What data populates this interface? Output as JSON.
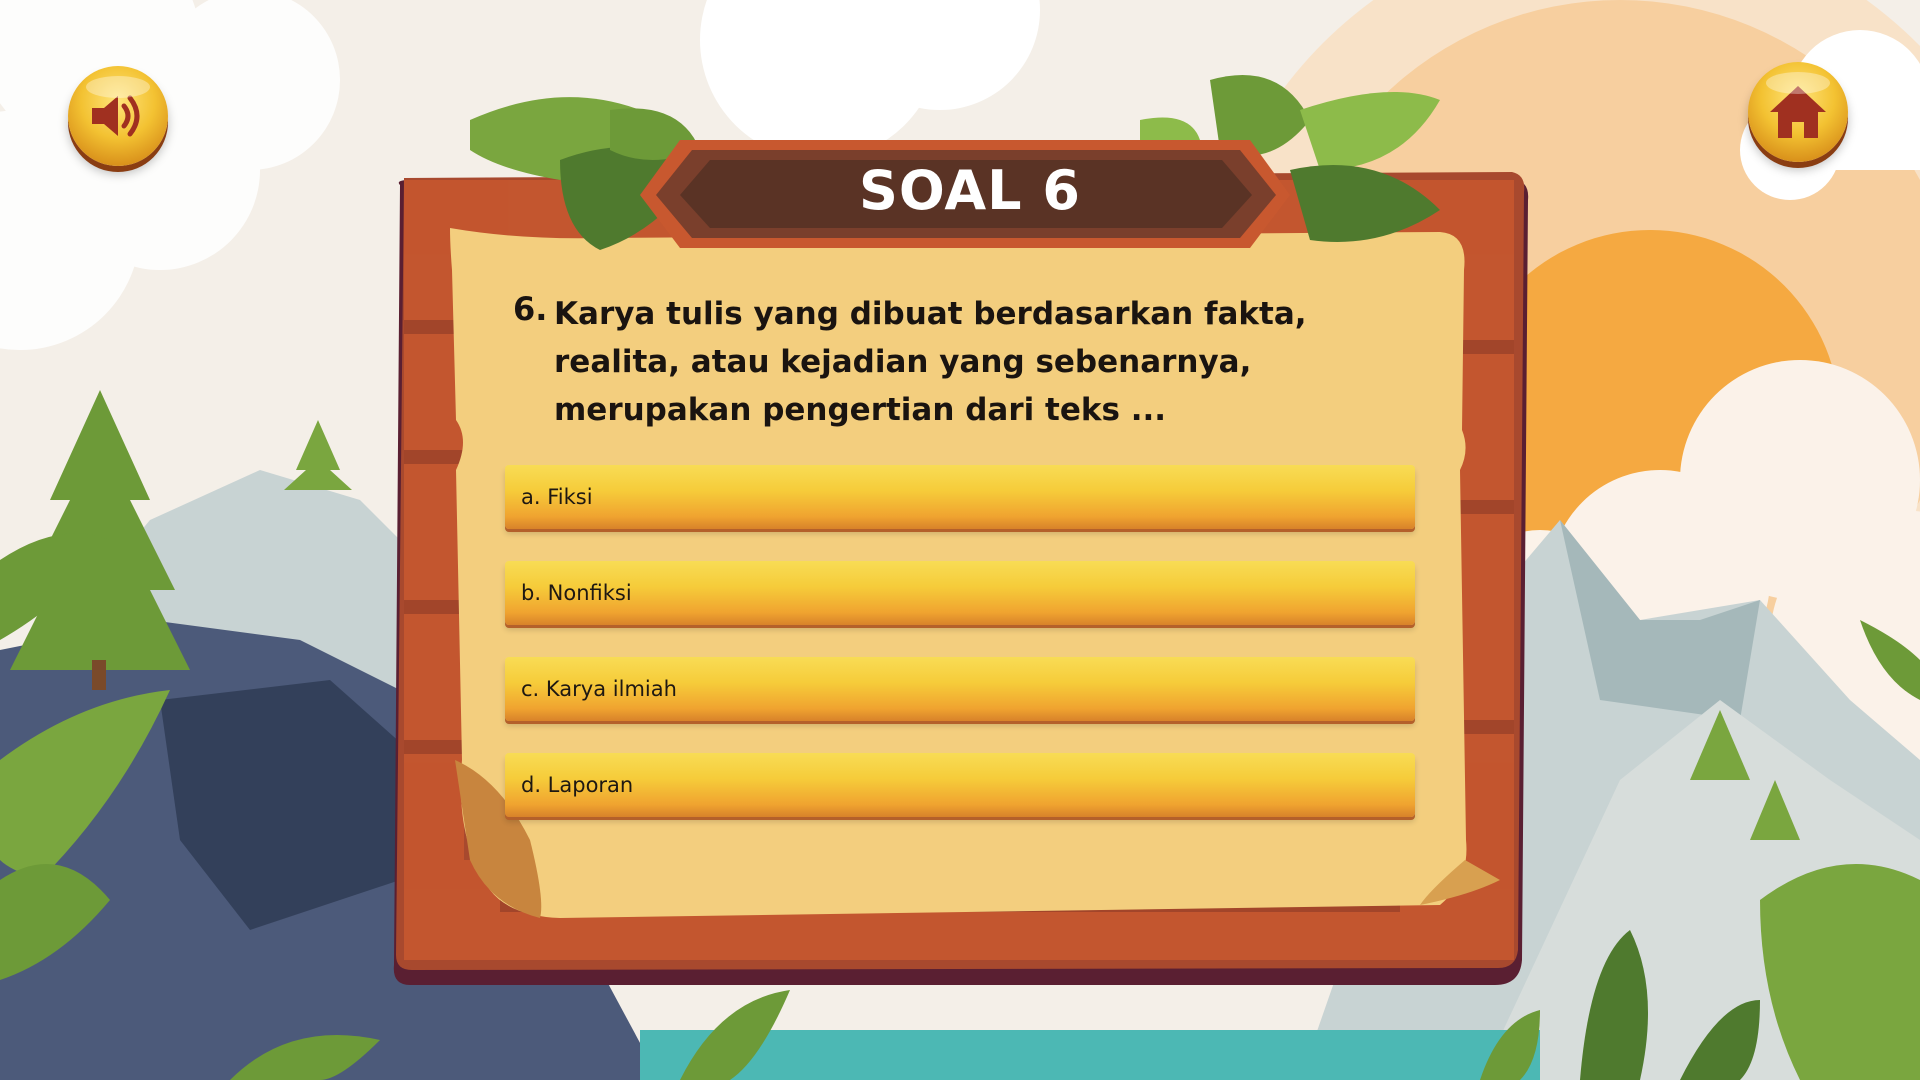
{
  "game": {
    "title": "SOAL 6",
    "question": {
      "number": "6.",
      "text": "Karya tulis yang dibuat berdasarkan fakta, realita, atau kejadian yang sebenarnya, merupakan pengertian dari teks ..."
    },
    "answers": [
      {
        "label": "a. Fiksi"
      },
      {
        "label": "b. Nonfiksi"
      },
      {
        "label": "c. Karya ilmiah"
      },
      {
        "label": "d. Laporan"
      }
    ],
    "buttons": {
      "sound_icon": "speaker-icon",
      "home_icon": "home-icon"
    }
  },
  "colors": {
    "sky": "#f4efe8",
    "sun": "#f5a941",
    "board_frame": "#a8492e",
    "parchment": "#f3ce7e",
    "answer_top": "#f8dc55",
    "answer_bottom": "#d8822a",
    "title_banner": "#5a3325",
    "water": "#4cb8b4"
  }
}
